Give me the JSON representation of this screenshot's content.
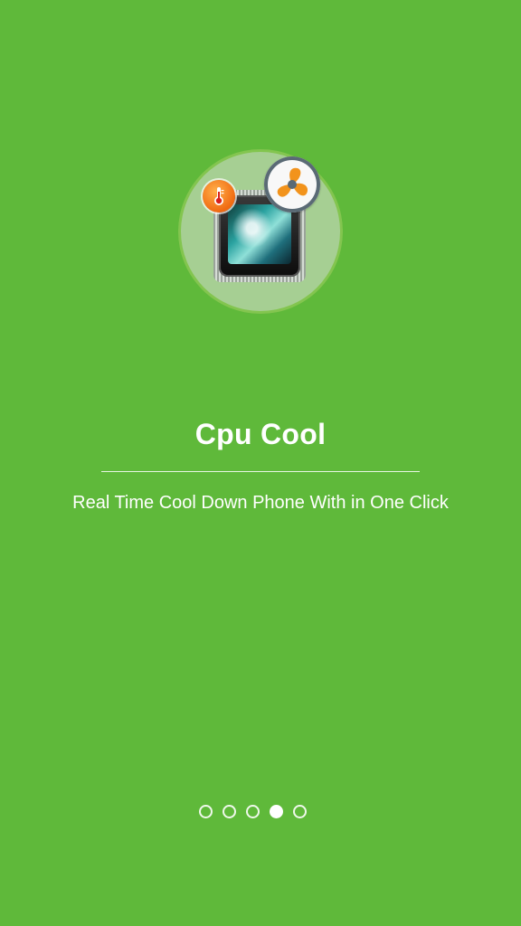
{
  "onboarding": {
    "title": "Cpu Cool",
    "subtitle": "Real Time Cool Down Phone With in One Click"
  },
  "pager": {
    "dots": [
      {
        "active": false
      },
      {
        "active": false
      },
      {
        "active": false
      },
      {
        "active": true
      },
      {
        "active": false
      }
    ],
    "current_page": 4,
    "total_pages": 5
  },
  "colors": {
    "background": "#5fb93a",
    "hero_circle": "#a6cf93",
    "accent_orange": "#f06a12",
    "text": "#ffffff"
  },
  "icons": [
    "cpu-chip-icon",
    "thermometer-icon",
    "fan-icon"
  ]
}
